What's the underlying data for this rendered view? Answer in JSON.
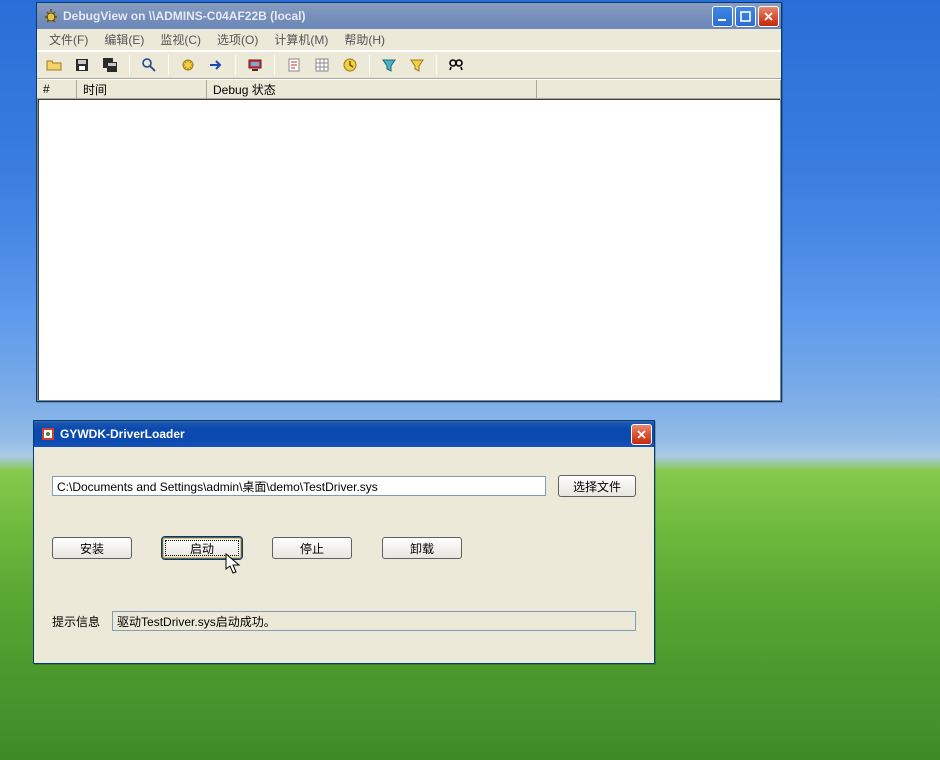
{
  "debugview": {
    "title": "DebugView on \\\\ADMINS-C04AF22B (local)",
    "menu": {
      "file": "文件(F)",
      "edit": "编辑(E)",
      "monitor": "监视(C)",
      "options": "选项(O)",
      "computer": "计算机(M)",
      "help": "帮助(H)"
    },
    "columns": {
      "num": "#",
      "time": "时间",
      "debug": "Debug 状态"
    }
  },
  "loader": {
    "title": "GYWDK-DriverLoader",
    "path": "C:\\Documents and Settings\\admin\\桌面\\demo\\TestDriver.sys",
    "buttons": {
      "choose": "选择文件",
      "install": "安装",
      "start": "启动",
      "stop": "停止",
      "unload": "卸载"
    },
    "status_label": "提示信息",
    "status_text": "驱动TestDriver.sys启动成功。"
  },
  "colors": {
    "titlebar_active": "#0a49ae",
    "close": "#d64a2a",
    "frame": "#ece9d8"
  }
}
